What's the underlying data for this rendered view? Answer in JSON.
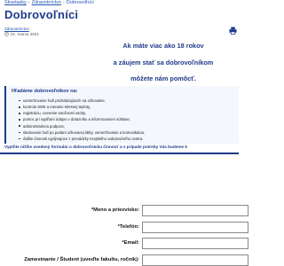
{
  "breadcrumb": {
    "items": [
      "Skvelasky",
      "Zdravotníctvo",
      "Dobrovoľníci"
    ],
    "separator": "›"
  },
  "page": {
    "title": "Dobrovoľníci",
    "tag": "Zdravotníctvo",
    "date": "01. marca 2021"
  },
  "hero": {
    "line1": "Ak máte viac ako 18 rokov",
    "line2": "a záujem stať sa dobrovoľníkom",
    "line3": "môžete nám pomôcť."
  },
  "needs": {
    "title": "Hľadáme dobrovoľníkov na:",
    "items": [
      "usmerňovanie ľudí prichádzajúcich na očkovanie,",
      "kontrolu SMS a meranie telesnej teploty,",
      "registráciu, overenie totožnosti osoby,",
      "pomoc pri vypĺňaní údajov v dotazníku a informovanom súhlase,",
      "administratívna podpora,",
      "sledovanie ľudí po podaní očkovacej látky, usmerňovanie a komunikácia,",
      "ďalšie činnosti vyplývajúce z prevádzky Krajského vakcinačného centra."
    ]
  },
  "instructions": "Vyplňte nižšie uvedený formulár o dobrovoľnícku činnosť a v prípade potreby Vás budeme k",
  "form": {
    "fields": [
      {
        "label": "*Meno a priezvisko:",
        "value": ""
      },
      {
        "label": "*Telefón:",
        "value": ""
      },
      {
        "label": "*Email:",
        "value": ""
      },
      {
        "label": "Zamestnanie / Študent (uveďte fakultu, ročník):",
        "value": ""
      }
    ]
  },
  "colors": {
    "accent": "#1f3a8a",
    "link": "#2554b7"
  }
}
